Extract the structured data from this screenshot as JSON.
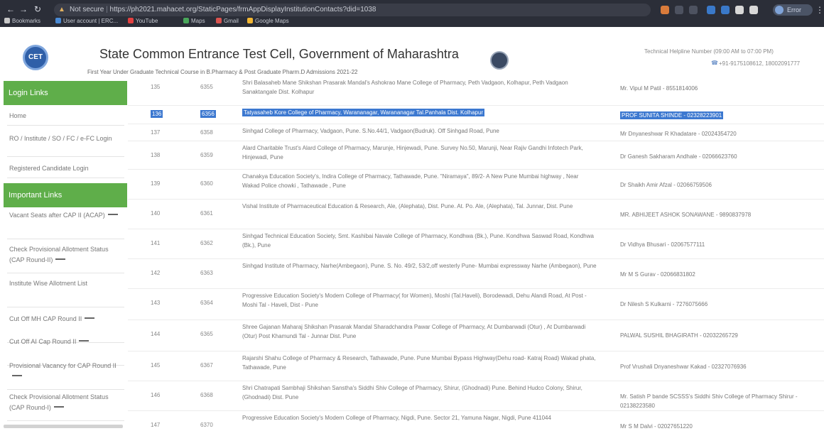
{
  "browser": {
    "security_label": "Not secure",
    "url": "https://ph2021.mahacet.org/StaticPages/frmAppDisplayInstitutionContacts?did=1038",
    "profile_label": "Error",
    "bookmarks": [
      {
        "label": "Bookmarks",
        "color": "#c8c8c8"
      },
      {
        "label": "User account | ERC...",
        "color": "#4a8ad4"
      },
      {
        "label": "YouTube",
        "color": "#e34040"
      },
      {
        "label": "Maps",
        "color": "#49a65a"
      },
      {
        "label": "Gmail",
        "color": "#d9534f"
      },
      {
        "label": "Google Maps",
        "color": "#f2b632"
      }
    ]
  },
  "header": {
    "logo_left_text": "CET",
    "title": "State Common Entrance Test Cell, Government of Maharashtra",
    "subtitle": "First Year Under Graduate Technical Course in B.Pharmacy & Post Graduate Pharm.D Admissions 2021-22",
    "helpline": "Technical Helpline Number (09:00 AM to 07:00 PM)",
    "phones": "+91-9175108612, 18002091777"
  },
  "sidebar": {
    "login_header": "Login Links",
    "login_links": [
      "Home",
      "RO / Institute / SO / FC / e-FC Login",
      "Registered Candidate Login"
    ],
    "important_header": "Important Links",
    "important_links": [
      "Vacant Seats after CAP II (ACAP)",
      "Check Provisional Allotment Status (CAP Round-II)",
      "Institute Wise Allotment List",
      "Cut Off MH CAP Round II",
      "Cut Off AI Cap Round II",
      "Provisional Vacancy for CAP Round II",
      "Check Provisional Allotment Status (CAP Round-I)"
    ]
  },
  "table": {
    "rows": [
      {
        "sr": "135",
        "code": "6355",
        "name": "Shri Balasaheb Mane Shikshan Prasarak Mandal's Ashokrao Mane College of Pharmacy, Peth Vadgaon, Kolhapur, Peth Vadgaon Sanaktangale Dist. Kolhapur",
        "contact": "Mr. Vipul M Patil - 8551814006",
        "highlight": false
      },
      {
        "sr": "136",
        "code": "6356",
        "name": "Tatyasaheb Kore College of Pharmacy, Warananagar, Warananagar Tal.Panhala Dist. Kolhapur",
        "contact": "PROF SUNITA SHINDE - 02328223901",
        "highlight": true
      },
      {
        "sr": "137",
        "code": "6358",
        "name": "Sinhgad College of Pharmacy, Vadgaon, Pune. S.No.44/1, Vadgaon(Budruk). Off Sinhgad Road, Pune",
        "contact": "Mr Dnyaneshwar R Khadatare - 02024354720",
        "highlight": false
      },
      {
        "sr": "138",
        "code": "6359",
        "name": "Alard Charitable Trust's Alard College of Pharmacy, Marunje, Hinjewadi, Pune. Survey No.50, Marunji, Near Rajiv Gandhi Infotech Park, Hinjewadi, Pune",
        "contact": "Dr Ganesh Sakharam Andhale - 02066623760",
        "highlight": false
      },
      {
        "sr": "139",
        "code": "6360",
        "name": "Chanakya Education Society's, Indira College of Pharmacy, Tathawade, Pune. \"Niramaya\", 89/2- A New Pune Mumbai highway , Near Wakad Police chowki , Tathawade , Pune",
        "contact": "Dr Shaikh Amir Afzal - 02066759506",
        "highlight": false
      },
      {
        "sr": "140",
        "code": "6361",
        "name": "Vishal Institute of Pharmaceutical Education & Research, Ale, (Alephata), Dist. Pune. At. Po. Ale, (Alephata), Tal. Junnar, Dist. Pune",
        "contact": "MR. ABHIJEET ASHOK SONAWANE - 9890837978",
        "highlight": false
      },
      {
        "sr": "141",
        "code": "6362",
        "name": "Sinhgad Technical Education Society, Smt. Kashibai Navale College of Pharmacy, Kondhwa (Bk.), Pune. Kondhwa Saswad Road, Kondhwa (Bk.), Pune",
        "contact": "Dr Vidhya Bhusari - 02067577111",
        "highlight": false
      },
      {
        "sr": "142",
        "code": "6363",
        "name": "Sinhgad Institute of Pharmacy, Narhe(Ambegaon), Pune. S. No. 49/2, 53/2,off westerly Pune- Mumbai expressway Narhe (Ambegaon), Pune",
        "contact": "Mr M S Gurav - 02066831802",
        "highlight": false
      },
      {
        "sr": "143",
        "code": "6364",
        "name": "Progressive Education Society's Modern College of Pharmacy( for Women), Moshi (Tal.Haveli), Borodewadi, Dehu Alandi Road, At Post - Moshi Tal - Haveli, Dist - Pune",
        "contact": "Dr Nilesh S Kulkarni - 7276075666",
        "highlight": false
      },
      {
        "sr": "144",
        "code": "6365",
        "name": "Shree Gajanan Maharaj Shikshan Prasarak Mandal Sharadchandra Pawar College of Pharmacy, At Dumbarwadi (Otur) , At Dumbarwadi (Otur) Post Khamundi Tal - Junnar Dist. Pune",
        "contact": "PALWAL SUSHIL BHAGIRATH - 02032265729",
        "highlight": false
      },
      {
        "sr": "145",
        "code": "6367",
        "name": "Rajarshi Shahu College of Pharmacy & Research, Tathawade, Pune. Pune Mumbai Bypass Highway(Dehu road- Katraj Road) Wakad phata, Tathawade, Pune",
        "contact": "Prof Vrushali Dnyaneshwar Kakad - 02327076936",
        "highlight": false
      },
      {
        "sr": "146",
        "code": "6368",
        "name": "Shri Chatrapati Sambhaji Shikshan Sanstha's Siddhi Shiv College of Pharmacy, Shirur, (Ghodnadi) Pune. Behind Hudco Colony, Shirur, (Ghodnadi) Dist. Pune",
        "contact": "Mr. Satish P bande SCSSS's Siddhi Shiv College of Pharmacy Shirur - 02138223580",
        "highlight": false
      },
      {
        "sr": "147",
        "code": "6370",
        "name": "Progressive Education Society's Modern College of Pharmacy, Nigdi, Pune. Sector 21, Yamuna Nagar, Nigdi, Pune 411044",
        "contact": "Mr S M Dalvi - 02027651220",
        "highlight": false
      }
    ]
  }
}
